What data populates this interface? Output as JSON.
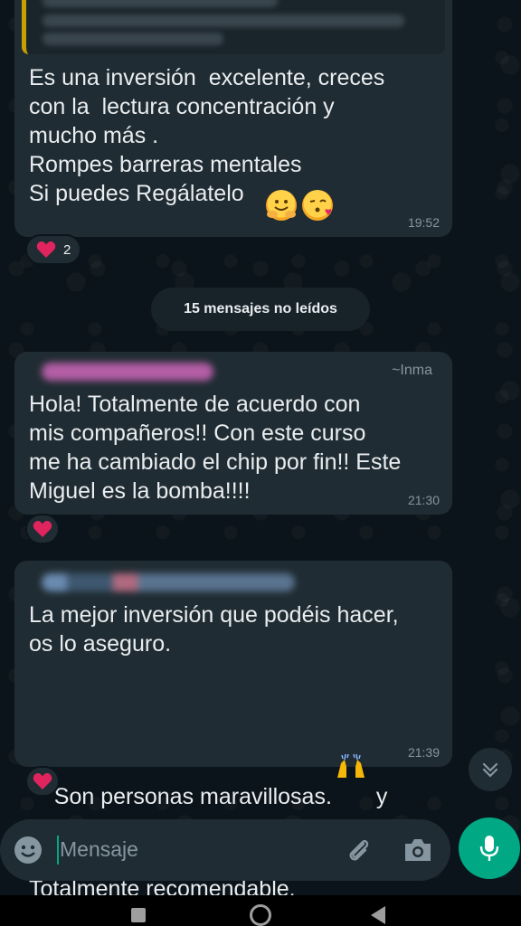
{
  "chat": {
    "messages": [
      {
        "text": "Es una inversión  excelente, creces\ncon la  lectura concentración y\nmucho más .\nRompes barreras mentales\nSi puedes Regálatelo",
        "time": "19:52",
        "reaction_count": "2"
      },
      {
        "push_name": "~Inma",
        "text": "Hola! Totalmente de acuerdo con\nmis compañeros!! Con este curso\nme ha cambiado el chip por fin!! Este\nMiguel es la bomba!!!!",
        "time": "21:30"
      },
      {
        "text_a": "La mejor inversión que podéis hacer,\nos lo aseguro.",
        "text_b": "Son personas maravillosas.",
        "text_b2": " y",
        "text_c": "conoceréis a gente maravillosa.\nTotalmente recomendable.",
        "time": "21:39"
      }
    ],
    "unread_label": "15 mensajes no leídos"
  },
  "composer": {
    "placeholder": "Mensaje"
  },
  "icons": {
    "emoji": "emoji-icon",
    "attach": "paperclip-icon",
    "camera": "camera-icon",
    "mic": "microphone-icon",
    "scroll": "chevron-double-down-icon",
    "heart": "heart-icon"
  },
  "colors": {
    "background": "#0b141a",
    "bubble": "#202c33",
    "accent": "#00a884",
    "reaction_heart": "#e0245e",
    "quote_bar": "#c6a000"
  }
}
